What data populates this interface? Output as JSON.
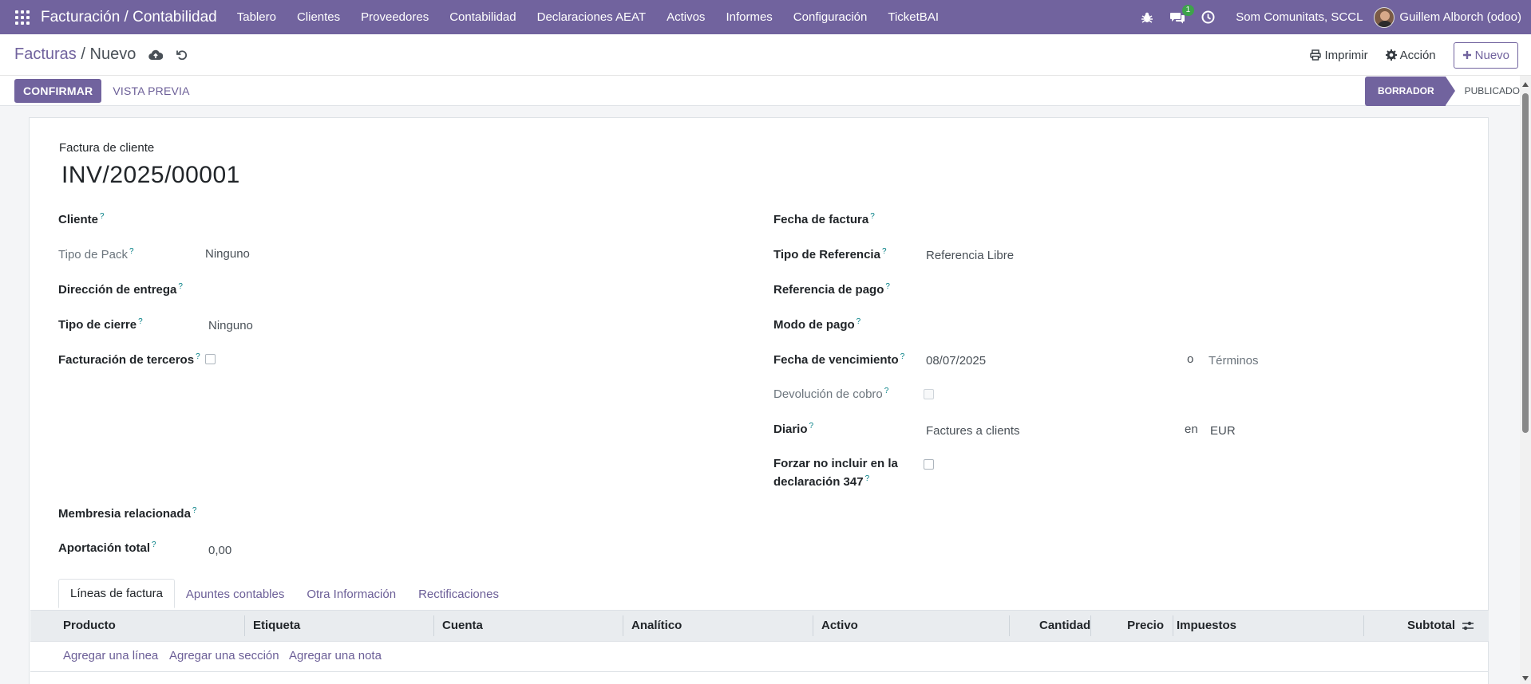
{
  "navbar": {
    "app_title": "Facturación / Contabilidad",
    "menu": [
      "Tablero",
      "Clientes",
      "Proveedores",
      "Contabilidad",
      "Declaraciones AEAT",
      "Activos",
      "Informes",
      "Configuración",
      "TicketBAI"
    ],
    "chat_badge": "1",
    "company": "Som Comunitats, SCCL",
    "user": "Guillem Alborch (odoo)",
    "icons": [
      "apps-grid-icon",
      "bug-icon",
      "chat-icon",
      "clock-icon"
    ]
  },
  "control": {
    "breadcrumb_parent": "Facturas",
    "breadcrumb_separator": "/",
    "breadcrumb_current": "Nuevo",
    "print_label": "Imprimir",
    "action_label": "Acción",
    "new_label": "Nuevo"
  },
  "statusbar": {
    "confirm_label": "CONFIRMAR",
    "preview_label": "VISTA PREVIA",
    "stages": [
      "BORRADOR",
      "PUBLICADO"
    ],
    "active_stage": "BORRADOR"
  },
  "form": {
    "doc_type": "Factura de cliente",
    "doc_name": "INV/2025/00001",
    "help_mark": "?",
    "left": {
      "cliente": "Cliente",
      "tipo_pack_label": "Tipo de Pack",
      "tipo_pack_value": "Ninguno",
      "direccion_entrega": "Dirección de entrega",
      "tipo_cierre_label": "Tipo de cierre",
      "tipo_cierre_value": "Ninguno",
      "facturacion_terceros": "Facturación de terceros",
      "membresia": "Membresia relacionada",
      "aportacion_label": "Aportación total",
      "aportacion_value": "0,00"
    },
    "right": {
      "fecha_factura": "Fecha de factura",
      "tipo_referencia_label": "Tipo de Referencia",
      "tipo_referencia_value": "Referencia Libre",
      "referencia_pago": "Referencia de pago",
      "modo_pago": "Modo de pago",
      "fecha_vencimiento_label": "Fecha de vencimiento",
      "fecha_vencimiento_value": "08/07/2025",
      "o_label": "o",
      "terminos_placeholder": "Términos",
      "devolucion_cobro": "Devolución de cobro",
      "diario_label": "Diario",
      "diario_value": "Factures a clients",
      "en_label": "en",
      "currency": "EUR",
      "forzar_line1": "Forzar no incluir en la",
      "forzar_line2": "declaración 347"
    }
  },
  "tabs": [
    "Líneas de factura",
    "Apuntes contables",
    "Otra Información",
    "Rectificaciones"
  ],
  "table": {
    "columns": [
      "Producto",
      "Etiqueta",
      "Cuenta",
      "Analítico",
      "Activo",
      "Cantidad",
      "Precio",
      "Impuestos",
      "Subtotal"
    ],
    "add_links": [
      "Agregar una línea",
      "Agregar una sección",
      "Agregar una nota"
    ]
  }
}
